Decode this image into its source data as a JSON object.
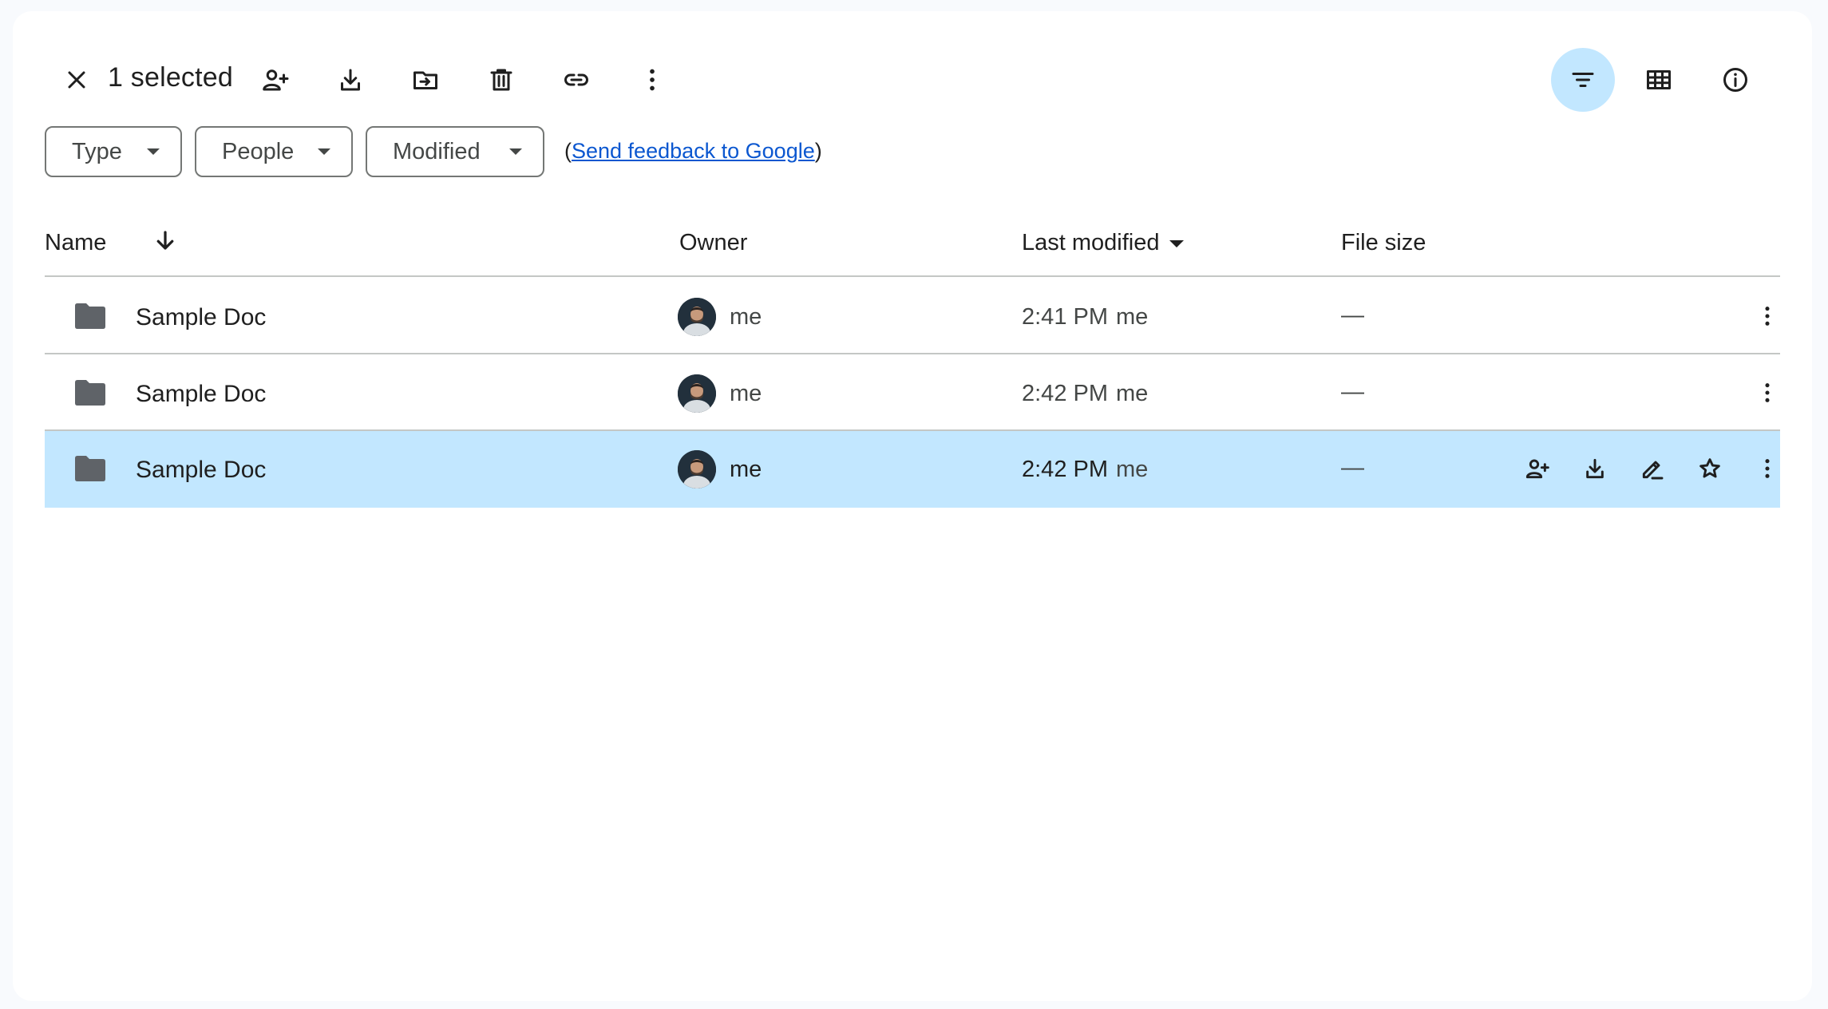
{
  "toolbar": {
    "selected_label": "1 selected",
    "actions": [
      "close-icon",
      "share-icon",
      "download-icon",
      "move-icon",
      "delete-icon",
      "link-icon",
      "more-icon"
    ],
    "view_actions": [
      "filter-icon",
      "grid-view-icon",
      "info-icon"
    ]
  },
  "filters": {
    "type": "Type",
    "people": "People",
    "modified": "Modified",
    "feedback_prefix": "(",
    "feedback_link": "Send feedback to Google",
    "feedback_suffix": ")"
  },
  "table": {
    "headers": {
      "name": "Name",
      "owner": "Owner",
      "last_modified": "Last modified",
      "file_size": "File size"
    },
    "rows": [
      {
        "name": "Sample Doc",
        "owner": "me",
        "time": "2:41 PM",
        "modified_by": "me",
        "size": "—",
        "selected": false
      },
      {
        "name": "Sample Doc",
        "owner": "me",
        "time": "2:42 PM",
        "modified_by": "me",
        "size": "—",
        "selected": false
      },
      {
        "name": "Sample Doc",
        "owner": "me",
        "time": "2:42 PM",
        "modified_by": "me",
        "size": "—",
        "selected": true
      }
    ]
  },
  "colors": {
    "selected_row": "#c2e7ff",
    "link": "#0b57d0",
    "folder": "#5f6368"
  }
}
